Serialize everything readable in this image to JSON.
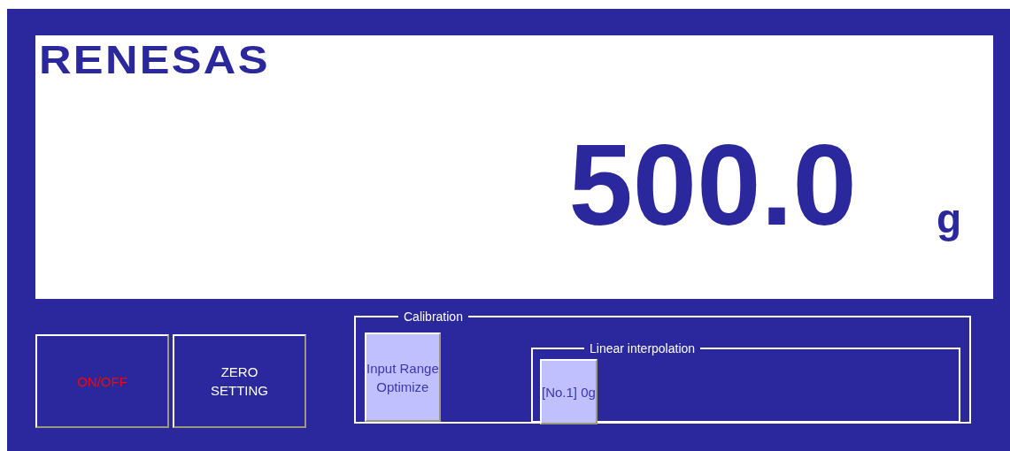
{
  "logo": {
    "text": "RENESAS"
  },
  "display": {
    "value": "500.0",
    "unit": "g"
  },
  "buttons": [
    {
      "label": "ON/OFF",
      "color": "#ff0000"
    },
    {
      "label": "ZERO\nSETTING",
      "color": "#ffffff"
    }
  ],
  "calibration": {
    "title": "Calibration",
    "button": "Input Range\nOptimize",
    "linear": {
      "title": "Linear interpolation",
      "points": [
        "[No.1] 0g"
      ]
    }
  }
}
